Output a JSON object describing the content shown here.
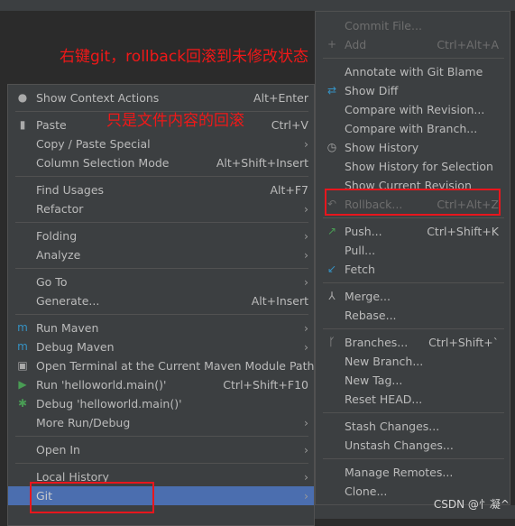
{
  "annotations": {
    "top": "右键git，rollback回滚到未修改状态",
    "middle": "只是文件内容的回滚"
  },
  "watermark": "CSDN @忄凝^",
  "colors": {
    "menu_bg": "#3c3f41",
    "selected": "#4b6eaf",
    "annotation": "#f01818"
  },
  "left_menu": [
    {
      "label": "Show Context Actions",
      "shortcut": "Alt+Enter",
      "icon": "lightbulb-icon"
    },
    {
      "sep": true
    },
    {
      "label": "Paste",
      "shortcut": "Ctrl+V",
      "icon": "clipboard-icon"
    },
    {
      "label": "Copy / Paste Special",
      "submenu": true
    },
    {
      "label": "Column Selection Mode",
      "shortcut": "Alt+Shift+Insert"
    },
    {
      "sep": true
    },
    {
      "label": "Find Usages",
      "shortcut": "Alt+F7"
    },
    {
      "label": "Refactor",
      "submenu": true
    },
    {
      "sep": true
    },
    {
      "label": "Folding",
      "submenu": true
    },
    {
      "label": "Analyze",
      "submenu": true
    },
    {
      "sep": true
    },
    {
      "label": "Go To",
      "submenu": true
    },
    {
      "label": "Generate...",
      "shortcut": "Alt+Insert"
    },
    {
      "sep": true
    },
    {
      "label": "Run Maven",
      "submenu": true,
      "icon": "maven-run-icon"
    },
    {
      "label": "Debug Maven",
      "submenu": true,
      "icon": "maven-debug-icon"
    },
    {
      "label": "Open Terminal at the Current Maven Module Path",
      "icon": "terminal-icon"
    },
    {
      "label": "Run 'helloworld.main()'",
      "shortcut": "Ctrl+Shift+F10",
      "icon": "run-icon"
    },
    {
      "label": "Debug 'helloworld.main()'",
      "icon": "debug-bug-icon"
    },
    {
      "label": "More Run/Debug",
      "submenu": true
    },
    {
      "sep": true
    },
    {
      "label": "Open In",
      "submenu": true
    },
    {
      "sep": true
    },
    {
      "label": "Local History",
      "submenu": true
    },
    {
      "label": "Git",
      "submenu": true,
      "selected": true
    }
  ],
  "right_menu": [
    {
      "label": "Commit File...",
      "disabled": true
    },
    {
      "label": "Add",
      "shortcut": "Ctrl+Alt+A",
      "disabled": true,
      "icon": "plus-icon"
    },
    {
      "sep": true
    },
    {
      "label": "Annotate with Git Blame"
    },
    {
      "label": "Show Diff",
      "icon": "diff-icon"
    },
    {
      "label": "Compare with Revision..."
    },
    {
      "label": "Compare with Branch..."
    },
    {
      "label": "Show History",
      "icon": "clock-icon"
    },
    {
      "label": "Show History for Selection"
    },
    {
      "label": "Show Current Revision"
    },
    {
      "label": "Rollback...",
      "shortcut": "Ctrl+Alt+Z",
      "disabled": true,
      "icon": "undo-icon"
    },
    {
      "sep": true
    },
    {
      "label": "Push...",
      "shortcut": "Ctrl+Shift+K",
      "icon": "push-arrow-icon"
    },
    {
      "label": "Pull..."
    },
    {
      "label": "Fetch",
      "icon": "fetch-icon"
    },
    {
      "sep": true
    },
    {
      "label": "Merge...",
      "icon": "merge-icon"
    },
    {
      "label": "Rebase..."
    },
    {
      "sep": true
    },
    {
      "label": "Branches...",
      "shortcut": "Ctrl+Shift+`",
      "icon": "branch-icon"
    },
    {
      "label": "New Branch..."
    },
    {
      "label": "New Tag..."
    },
    {
      "label": "Reset HEAD..."
    },
    {
      "sep": true
    },
    {
      "label": "Stash Changes..."
    },
    {
      "label": "Unstash Changes..."
    },
    {
      "sep": true
    },
    {
      "label": "Manage Remotes..."
    },
    {
      "label": "Clone..."
    }
  ]
}
